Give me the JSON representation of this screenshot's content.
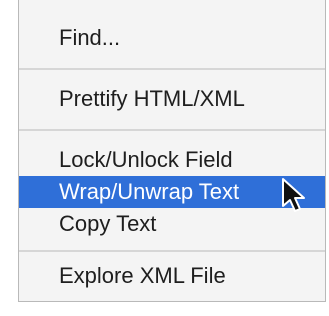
{
  "menu": {
    "items": [
      {
        "label": "Find...",
        "highlighted": false
      },
      {
        "label": "Prettify HTML/XML",
        "highlighted": false
      },
      {
        "label": "Lock/Unlock Field",
        "highlighted": false
      },
      {
        "label": "Wrap/Unwrap Text",
        "highlighted": true
      },
      {
        "label": "Copy Text",
        "highlighted": false
      },
      {
        "label": "Explore XML File",
        "highlighted": false
      }
    ]
  },
  "colors": {
    "highlight": "#2f6fd8",
    "menu_background": "#f4f4f4",
    "separator": "#d6d6d6"
  },
  "icons": {
    "cursor": "arrow-cursor-icon"
  }
}
